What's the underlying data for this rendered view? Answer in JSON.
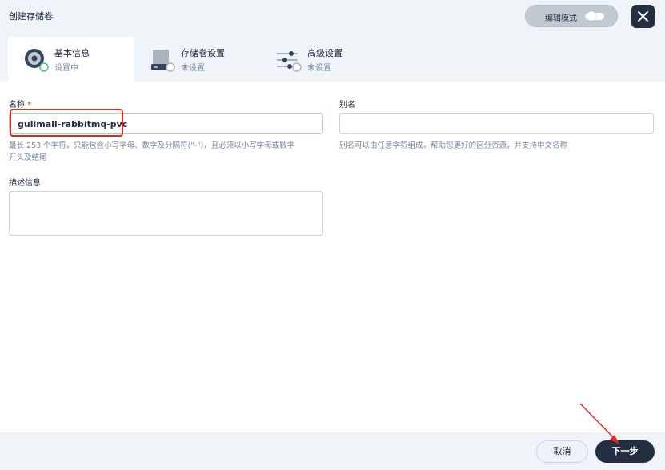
{
  "header": {
    "title": "创建存储卷",
    "edit_mode_label": "编辑模式",
    "close_icon": "close-icon"
  },
  "steps": [
    {
      "name": "基本信息",
      "status": "设置中",
      "icon": "disk-icon"
    },
    {
      "name": "存储卷设置",
      "status": "未设置",
      "icon": "storage-drive-icon"
    },
    {
      "name": "高级设置",
      "status": "未设置",
      "icon": "sliders-icon"
    }
  ],
  "form": {
    "name": {
      "label": "名称",
      "required_mark": "*",
      "value": "gulimall-rabbitmq-pvc",
      "hint_line1": "最长 253 个字符，只能包含小写字母、数字及分隔符(\"-\")，且必须以小写字母或数字",
      "hint_line2": "开头及结尾"
    },
    "alias": {
      "label": "别名",
      "value": "",
      "hint": "别名可以由任意字符组成，帮助您更好的区分资源，并支持中文名称"
    },
    "description": {
      "label": "描述信息",
      "value": ""
    }
  },
  "footer": {
    "cancel_label": "取消",
    "next_label": "下一步"
  },
  "colors": {
    "primary_dark": "#242e42",
    "background_light": "#eff4f9",
    "annotation_red": "#e3281f",
    "status_green": "#55bc8a"
  }
}
